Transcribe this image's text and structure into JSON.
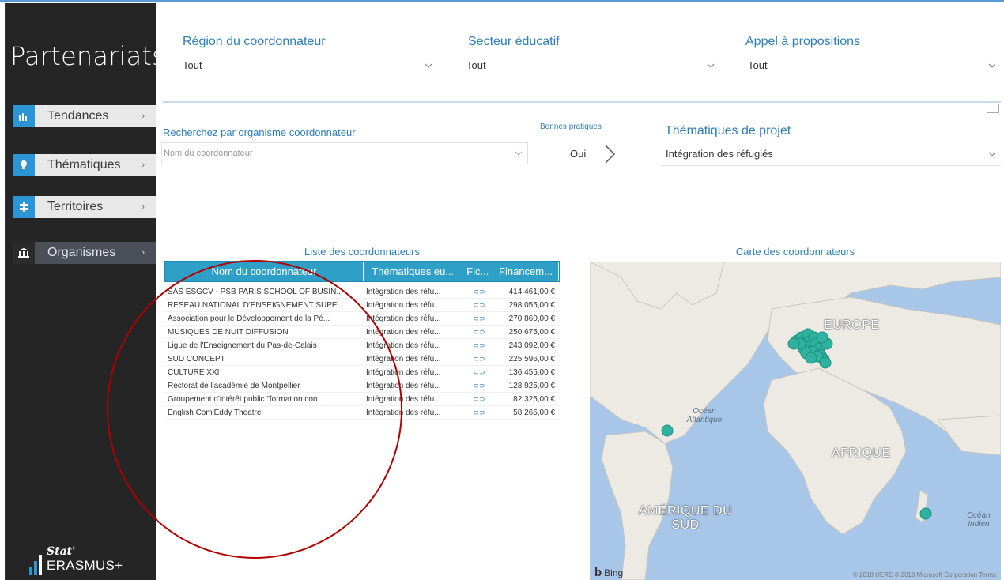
{
  "sidebar": {
    "title": "Partenariats",
    "items": [
      {
        "label": "Tendances",
        "icon": "bar-chart-icon"
      },
      {
        "label": "Thématiques",
        "icon": "lightbulb-icon"
      },
      {
        "label": "Territoires",
        "icon": "signpost-icon"
      },
      {
        "label": "Organismes",
        "icon": "building-icon"
      }
    ],
    "logo_top": "Stat'",
    "logo_bottom": "ERASMUS+"
  },
  "filters": {
    "region": {
      "label": "Région du coordonnateur",
      "value": "Tout"
    },
    "secteur": {
      "label": "Secteur éducatif",
      "value": "Tout"
    },
    "appel": {
      "label": "Appel à propositions",
      "value": "Tout"
    },
    "search": {
      "label": "Recherchez par organisme coordonnateur",
      "placeholder": "Nom du coordonnateur"
    },
    "bonnes_pratiques": {
      "label": "Bonnes pratiques",
      "value": "Oui"
    },
    "thematiques": {
      "label": "Thématiques de projet",
      "value": "Intégration des réfugiés"
    }
  },
  "table": {
    "title": "Liste des coordonnateurs",
    "columns": [
      "Nom du coordonnateur",
      "Thématiques eu...",
      "Fic...",
      "Financem..."
    ],
    "rows": [
      {
        "name": "SAS ESGCV - PSB PARIS SCHOOL OF BUSIN...",
        "theme": "Intégration des réfu...",
        "amount": "414 461,00 €"
      },
      {
        "name": "RESEAU NATIONAL D'ENSEIGNEMENT SUPE...",
        "theme": "Intégration des réfu...",
        "amount": "298 055,00 €"
      },
      {
        "name": "Association pour le Développement de la Pé...",
        "theme": "Intégration des réfu...",
        "amount": "270 860,00 €"
      },
      {
        "name": "MUSIQUES DE NUIT DIFFUSION",
        "theme": "Intégration des réfu...",
        "amount": "250 675,00 €"
      },
      {
        "name": "Ligue de l'Enseignement du Pas-de-Calais",
        "theme": "Intégration des réfu...",
        "amount": "243 092,00 €"
      },
      {
        "name": "SUD CONCEPT",
        "theme": "Intégration des réfu...",
        "amount": "225 596,00 €"
      },
      {
        "name": "CULTURE XXI",
        "theme": "Intégration des réfu...",
        "amount": "136 455,00 €"
      },
      {
        "name": "Rectorat de l'académie de Montpellier",
        "theme": "Intégration des réfu...",
        "amount": "128 925,00 €"
      },
      {
        "name": "Groupement d'intérêt public \"formation con...",
        "theme": "Intégration des réfu...",
        "amount": "82 325,00 €"
      },
      {
        "name": "English Com'Eddy Theatre",
        "theme": "Intégration des réfu...",
        "amount": "58 265,00 €"
      }
    ]
  },
  "map": {
    "title": "Carte des coordonnateurs",
    "labels": {
      "europe": "EUROPE",
      "afrique": "AFRIQUE",
      "amerique": "AMÉRIQUE DU SUD",
      "atlantique": "Océan Atlantique",
      "indien": "Océan Indien"
    },
    "provider": "Bing",
    "attribution": "© 2018 HERE © 2018 Microsoft Corporation  Terms"
  },
  "colors": {
    "accent": "#2b95d6",
    "header": "#2ea0c8",
    "marker": "#2fb3a0",
    "annotation": "#b30000"
  }
}
